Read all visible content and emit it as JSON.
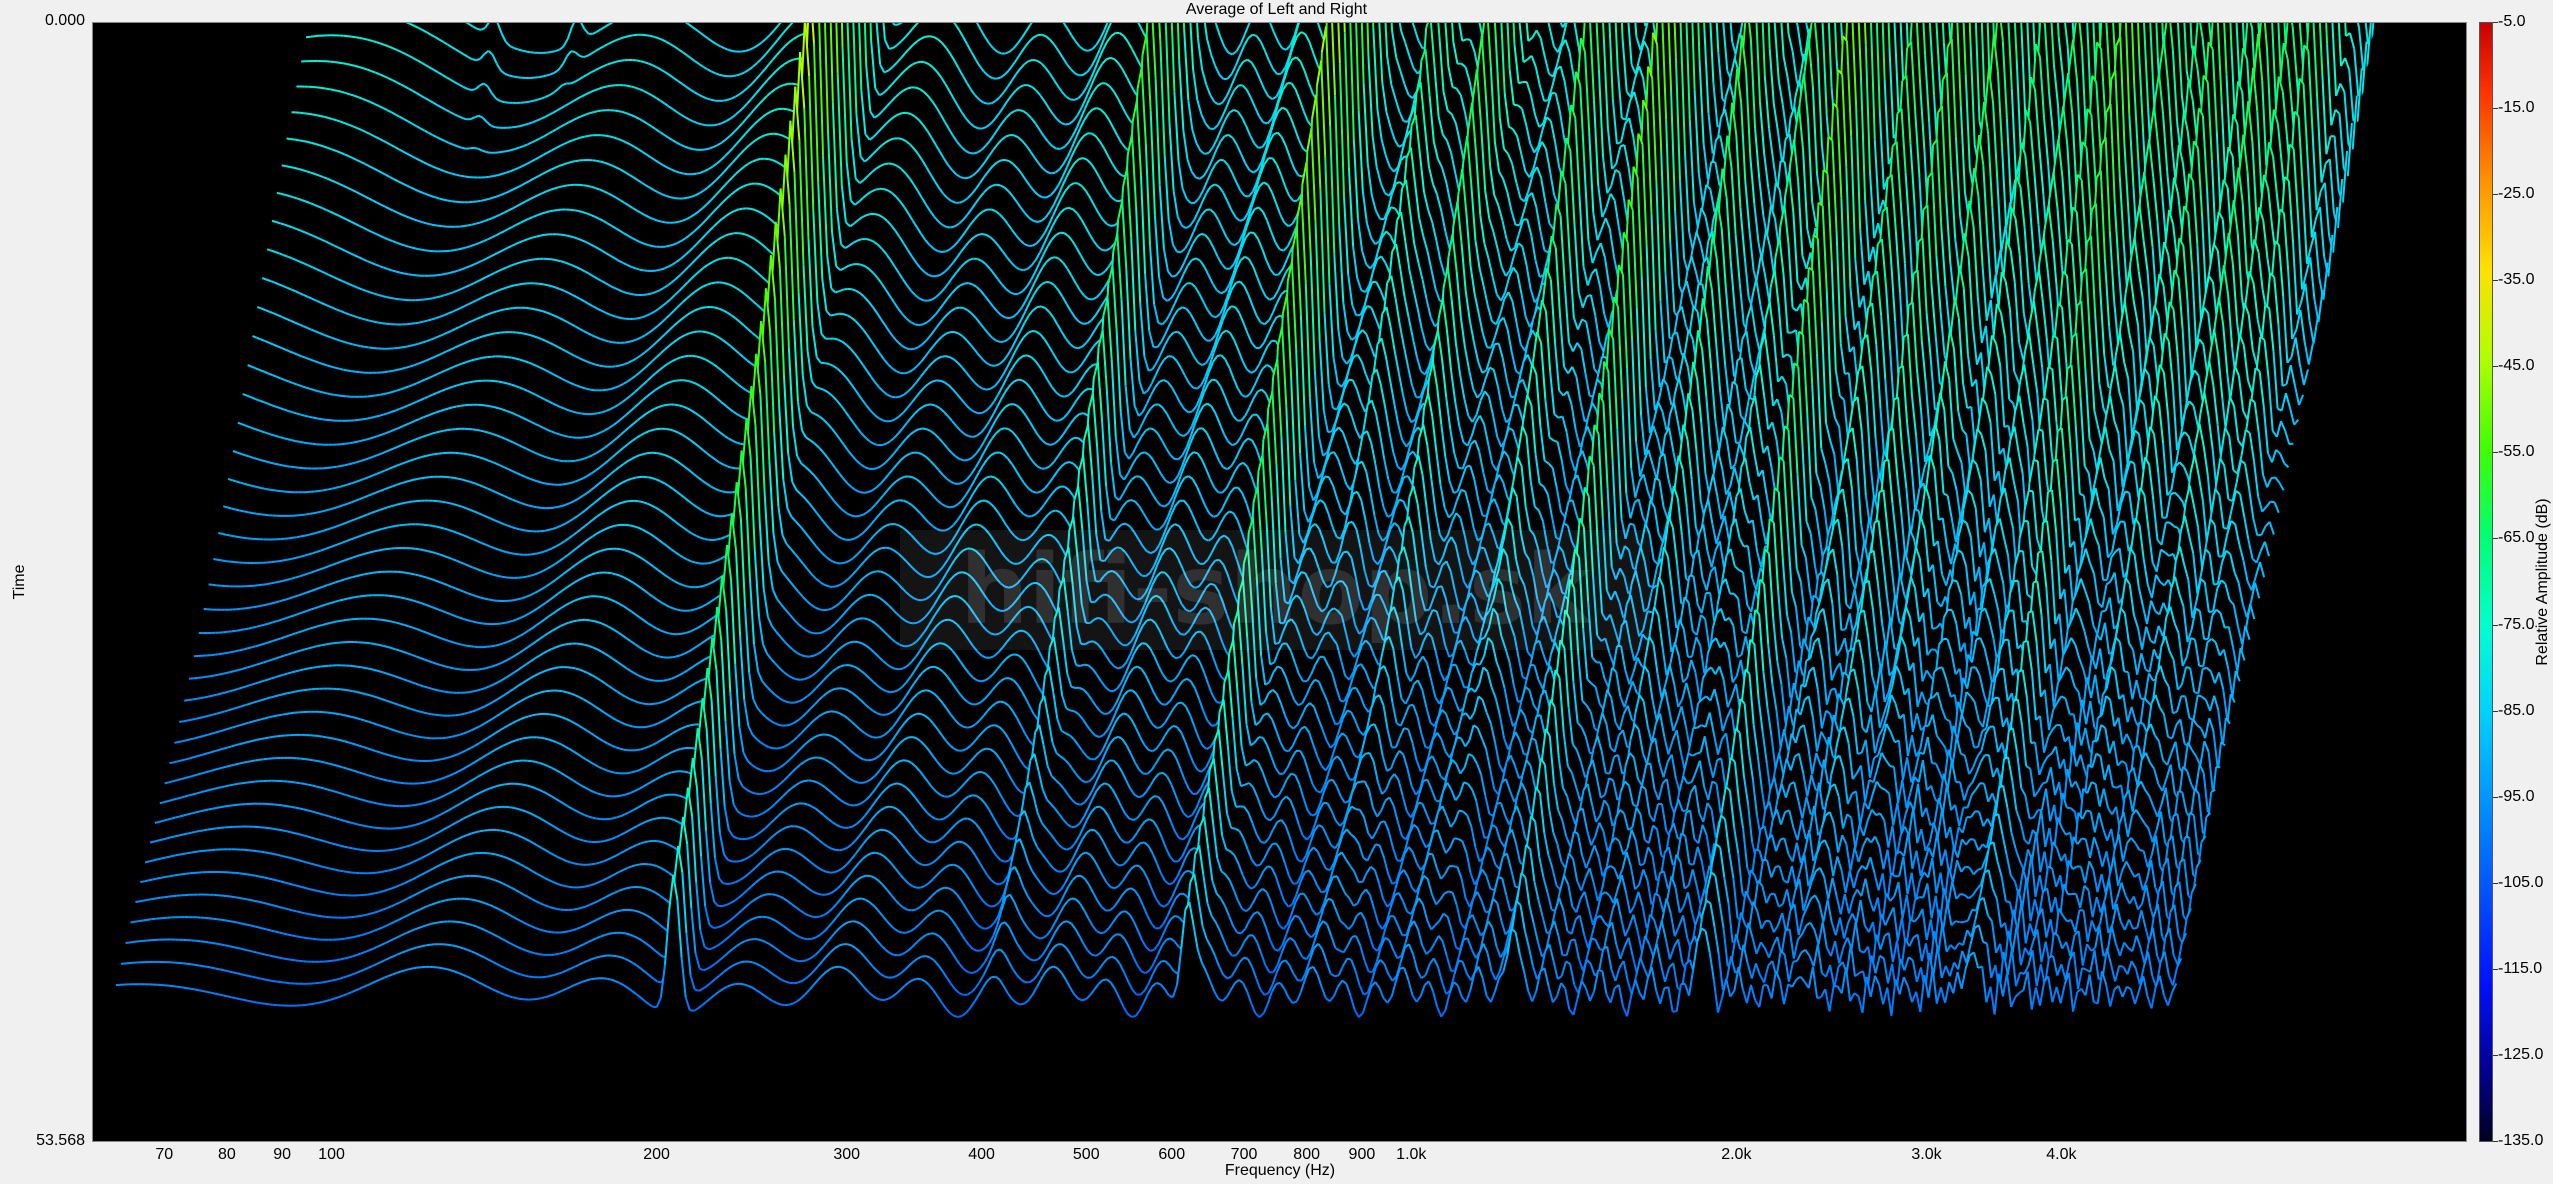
{
  "chart_data": {
    "type": "waterfall",
    "title": "Average of Left and Right",
    "xlabel": "Frequency (Hz)",
    "ylabel": "Time",
    "zlabel": "Relative Amplitude (dB)",
    "x_scale": "log",
    "xlim": [
      60,
      9500
    ],
    "x_ticks": [
      {
        "value": 70,
        "label": "70"
      },
      {
        "value": 80,
        "label": "80"
      },
      {
        "value": 90,
        "label": "90"
      },
      {
        "value": 100,
        "label": "100"
      },
      {
        "value": 200,
        "label": "200"
      },
      {
        "value": 300,
        "label": "300"
      },
      {
        "value": 400,
        "label": "400"
      },
      {
        "value": 500,
        "label": "500"
      },
      {
        "value": 600,
        "label": "600"
      },
      {
        "value": 700,
        "label": "700"
      },
      {
        "value": 800,
        "label": "800"
      },
      {
        "value": 900,
        "label": "900"
      },
      {
        "value": 1000,
        "label": "1.0k"
      },
      {
        "value": 2000,
        "label": "2.0k"
      },
      {
        "value": 3000,
        "label": "3.0k"
      },
      {
        "value": 4000,
        "label": "4.0k"
      }
    ],
    "y_range": [
      0.0,
      53.568
    ],
    "y_ticks": [
      "0.000",
      "53.568"
    ],
    "colorbar": {
      "range": [
        -135.0,
        -5.0
      ],
      "ticks": [
        "-5.0",
        "-15.0",
        "-25.0",
        "-35.0",
        "-45.0",
        "-55.0",
        "-65.0",
        "-75.0",
        "-85.0",
        "-95.0",
        "-105.0",
        "-115.0",
        "-125.0",
        "-135.0"
      ],
      "colors": [
        "#c80000",
        "#ff9000",
        "#ffe000",
        "#40ff00",
        "#00ffd0",
        "#0090ff",
        "#0010ff",
        "#000020"
      ]
    },
    "peaks_db": [
      {
        "freq": 92,
        "db": -80
      },
      {
        "freq": 110,
        "db": -80
      },
      {
        "freq": 207,
        "db": -20
      },
      {
        "freq": 410,
        "db": -40
      },
      {
        "freq": 620,
        "db": -25
      },
      {
        "freq": 720,
        "db": -55
      },
      {
        "freq": 830,
        "db": -45
      },
      {
        "freq": 1030,
        "db": -45
      },
      {
        "freq": 1240,
        "db": -30
      },
      {
        "freq": 1450,
        "db": -45
      },
      {
        "freq": 1650,
        "db": -50
      },
      {
        "freq": 1860,
        "db": -30
      },
      {
        "freq": 2070,
        "db": -45
      },
      {
        "freq": 2280,
        "db": -40
      },
      {
        "freq": 2480,
        "db": -45
      },
      {
        "freq": 2690,
        "db": -50
      },
      {
        "freq": 2900,
        "db": -50
      },
      {
        "freq": 3100,
        "db": -45
      },
      {
        "freq": 3300,
        "db": -35
      },
      {
        "freq": 3520,
        "db": -50
      },
      {
        "freq": 3720,
        "db": -55
      },
      {
        "freq": 3930,
        "db": -45
      },
      {
        "freq": 4140,
        "db": -55
      },
      {
        "freq": 4350,
        "db": -45
      },
      {
        "freq": 4560,
        "db": -50
      },
      {
        "freq": 4770,
        "db": -50
      }
    ],
    "noise_floor_db": -80
  },
  "watermark": "hifi-shop.sk"
}
